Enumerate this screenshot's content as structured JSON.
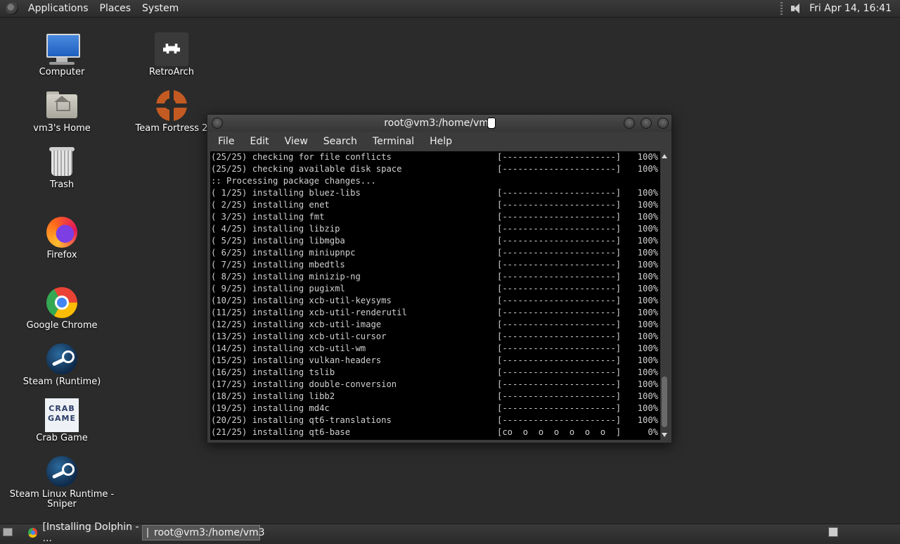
{
  "top_panel": {
    "menus": [
      "Applications",
      "Places",
      "System"
    ],
    "clock": "Fri Apr 14, 16:41"
  },
  "desktop_icons": [
    {
      "label": "Computer",
      "icon": "computer-icon"
    },
    {
      "label": "vm3's Home",
      "icon": "home-folder-icon"
    },
    {
      "label": "Trash",
      "icon": "trash-icon"
    },
    {
      "label": "Firefox",
      "icon": "firefox-icon"
    },
    {
      "label": "Google Chrome",
      "icon": "chrome-icon"
    },
    {
      "label": "Steam (Runtime)",
      "icon": "steam-icon"
    },
    {
      "label": "Crab Game",
      "icon": "crab-game-icon"
    },
    {
      "label": "Steam Linux Runtime - Sniper",
      "icon": "steam-icon"
    },
    {
      "label": "RetroArch",
      "icon": "retroarch-icon"
    },
    {
      "label": "Team Fortress 2",
      "icon": "tf2-icon"
    }
  ],
  "crab_game_text": "CRAB GAME",
  "terminal": {
    "title": "root@vm3:/home/vm3",
    "menu": [
      "File",
      "Edit",
      "View",
      "Search",
      "Terminal",
      "Help"
    ],
    "lines": [
      {
        "text": "(25/25) checking for file conflicts",
        "bar": "[----------------------]",
        "pct": "100%"
      },
      {
        "text": "(25/25) checking available disk space",
        "bar": "[----------------------]",
        "pct": "100%"
      },
      {
        "text": ":: Processing package changes...",
        "bar": "",
        "pct": ""
      },
      {
        "text": "( 1/25) installing bluez-libs",
        "bar": "[----------------------]",
        "pct": "100%"
      },
      {
        "text": "( 2/25) installing enet",
        "bar": "[----------------------]",
        "pct": "100%"
      },
      {
        "text": "( 3/25) installing fmt",
        "bar": "[----------------------]",
        "pct": "100%"
      },
      {
        "text": "( 4/25) installing libzip",
        "bar": "[----------------------]",
        "pct": "100%"
      },
      {
        "text": "( 5/25) installing libmgba",
        "bar": "[----------------------]",
        "pct": "100%"
      },
      {
        "text": "( 6/25) installing miniupnpc",
        "bar": "[----------------------]",
        "pct": "100%"
      },
      {
        "text": "( 7/25) installing mbedtls",
        "bar": "[----------------------]",
        "pct": "100%"
      },
      {
        "text": "( 8/25) installing minizip-ng",
        "bar": "[----------------------]",
        "pct": "100%"
      },
      {
        "text": "( 9/25) installing pugixml",
        "bar": "[----------------------]",
        "pct": "100%"
      },
      {
        "text": "(10/25) installing xcb-util-keysyms",
        "bar": "[----------------------]",
        "pct": "100%"
      },
      {
        "text": "(11/25) installing xcb-util-renderutil",
        "bar": "[----------------------]",
        "pct": "100%"
      },
      {
        "text": "(12/25) installing xcb-util-image",
        "bar": "[----------------------]",
        "pct": "100%"
      },
      {
        "text": "(13/25) installing xcb-util-cursor",
        "bar": "[----------------------]",
        "pct": "100%"
      },
      {
        "text": "(14/25) installing xcb-util-wm",
        "bar": "[----------------------]",
        "pct": "100%"
      },
      {
        "text": "(15/25) installing vulkan-headers",
        "bar": "[----------------------]",
        "pct": "100%"
      },
      {
        "text": "(16/25) installing tslib",
        "bar": "[----------------------]",
        "pct": "100%"
      },
      {
        "text": "(17/25) installing double-conversion",
        "bar": "[----------------------]",
        "pct": "100%"
      },
      {
        "text": "(18/25) installing libb2",
        "bar": "[----------------------]",
        "pct": "100%"
      },
      {
        "text": "(19/25) installing md4c",
        "bar": "[----------------------]",
        "pct": "100%"
      },
      {
        "text": "(20/25) installing qt6-translations",
        "bar": "[----------------------]",
        "pct": "100%"
      },
      {
        "text": "(21/25) installing qt6-base",
        "bar": "[co  o  o  o  o  o  o  ]",
        "pct": "0%"
      }
    ]
  },
  "taskbar": {
    "tasks": [
      {
        "label": "[Installing Dolphin - ...",
        "icon": "chrome-icon",
        "active": false
      },
      {
        "label": "root@vm3:/home/vm3",
        "icon": "terminal-icon",
        "active": true
      }
    ]
  }
}
